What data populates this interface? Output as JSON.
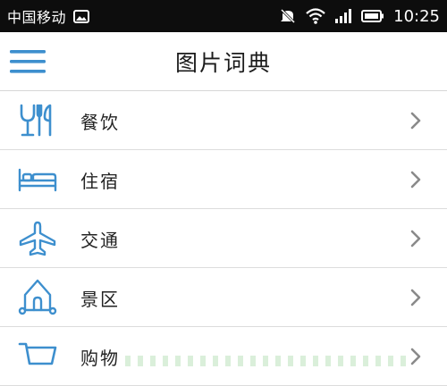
{
  "status_bar": {
    "carrier": "中国移动",
    "time": "10:25",
    "icons": [
      "image-icon",
      "mute-icon",
      "wifi-icon",
      "signal-icon",
      "battery-icon"
    ]
  },
  "header": {
    "title": "图片词典",
    "menu_icon": "hamburger-menu-icon"
  },
  "categories": [
    {
      "label": "餐饮",
      "icon": "dining-icon"
    },
    {
      "label": "住宿",
      "icon": "bed-icon"
    },
    {
      "label": "交通",
      "icon": "airplane-icon"
    },
    {
      "label": "景区",
      "icon": "house-icon"
    },
    {
      "label": "购物",
      "icon": "shopping-cart-icon"
    }
  ],
  "colors": {
    "accent": "#3d8fce",
    "status_bar_bg": "#0d0d0d",
    "chevron": "#8a8a8a",
    "divider": "#dcdcdc"
  }
}
